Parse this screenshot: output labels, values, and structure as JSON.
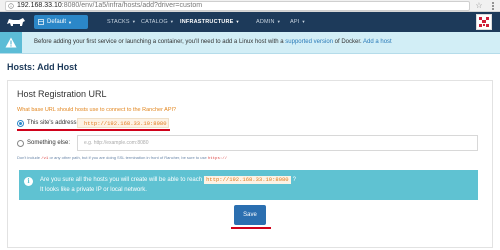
{
  "browser": {
    "url_host": "192.168.33.10",
    "url_path": ":8080/env/1a5/infra/hosts/add?driver=custom"
  },
  "navbar": {
    "environment_label": "Default",
    "items": [
      {
        "label": "STACKS"
      },
      {
        "label": "CATALOG"
      },
      {
        "label": "INFRASTRUCTURE"
      },
      {
        "label": "ADMIN"
      },
      {
        "label": "API"
      }
    ]
  },
  "alert": {
    "text_before": "Before adding your first service or launching a container, you'll need to add a Linux host with a ",
    "link_supported": "supported version",
    "text_middle": " of Docker. ",
    "link_add_host": "Add a host"
  },
  "page": {
    "title": "Hosts: Add Host"
  },
  "registration": {
    "title": "Host Registration URL",
    "subtitle": "What base URL should hosts use to connect to the Rancher API?",
    "option_site_label": "This site's address:",
    "site_address": "http://192.168.33.10:8080",
    "option_other_label": "Something else:",
    "other_placeholder": "e.g. http://example.com:8080",
    "hint_before": "Don't include ",
    "hint_code1": "/v1",
    "hint_middle": " or any other path, but if you are doing SSL termination in front of Rancher, be sure to use ",
    "hint_code2": "https://"
  },
  "info": {
    "line1_before": "Are you sure all the hosts you will create will be able to reach",
    "address": "http://192.168.33.10:8080",
    "line1_after": "?",
    "line2": "It looks like a private IP or local network."
  },
  "actions": {
    "save_label": "Save"
  },
  "colors": {
    "navbar": "#1d3a5a",
    "accent": "#2b87c8",
    "alert_bg": "#d2eef6",
    "info_bg": "#5fc2d2",
    "highlight_underline": "#d0021b"
  }
}
